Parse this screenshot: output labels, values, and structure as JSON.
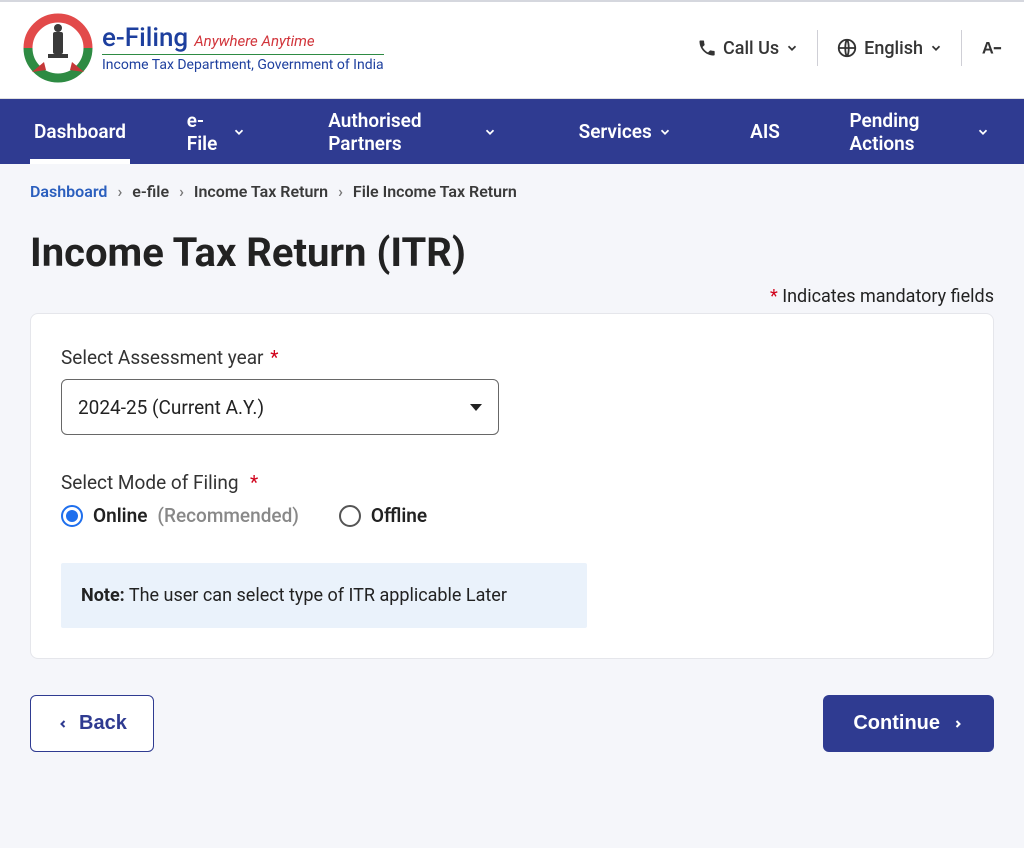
{
  "header": {
    "logo_title": "e-Filing",
    "logo_tag": "Anywhere Anytime",
    "logo_sub": "Income Tax Department, Government of India",
    "call_us": "Call Us",
    "language": "English"
  },
  "nav": {
    "items": [
      "Dashboard",
      "e-File",
      "Authorised Partners",
      "Services",
      "AIS",
      "Pending Actions"
    ]
  },
  "breadcrumb": {
    "items": [
      "Dashboard",
      "e-file",
      "Income Tax Return",
      "File Income Tax Return"
    ]
  },
  "page": {
    "title": "Income Tax Return (ITR)",
    "mandatory_text": "Indicates mandatory fields"
  },
  "form": {
    "assessment_label": "Select Assessment year",
    "assessment_value": "2024-25 (Current A.Y.)",
    "mode_label": "Select Mode of Filing",
    "mode_online_label": "Online",
    "mode_online_rec": "(Recommended)",
    "mode_offline_label": "Offline",
    "note_label": "Note:",
    "note_text": "The user can select type of ITR applicable Later"
  },
  "buttons": {
    "back": "Back",
    "continue": "Continue"
  }
}
